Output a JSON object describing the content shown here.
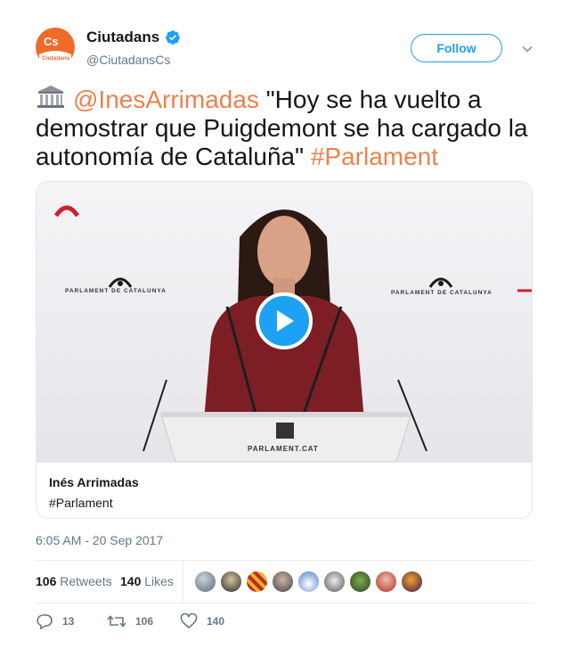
{
  "account": {
    "name": "Ciutadans",
    "handle": "@CiutadansCs",
    "logo_text": "Cs",
    "logo_sub": "Ciutadans",
    "brand_color": "#f06a2a",
    "verified": true
  },
  "follow_button": "Follow",
  "tweet": {
    "mention": "@InesArrimadas",
    "quote": " \"Hoy se ha vuelto a demostrar que Puigdemont se ha cargado la autonomía de Cataluña\" ",
    "hashtag": "#Parlament",
    "emoji": "museum-icon"
  },
  "card": {
    "title": "Inés Arrimadas",
    "description": "#Parlament",
    "podium_text": "PARLAMENT.CAT",
    "backdrop_text": "PARLAMENT DE CATALUNYA"
  },
  "timestamp": "6:05 AM - 20 Sep 2017",
  "stats": {
    "retweets_count": "106",
    "retweets_label": "Retweets",
    "likes_count": "140",
    "likes_label": "Likes"
  },
  "actions": {
    "replies": "13",
    "retweets": "106",
    "likes": "140"
  },
  "colors": {
    "link": "#e8834f",
    "accent": "#1da1f2",
    "muted": "#657786"
  }
}
